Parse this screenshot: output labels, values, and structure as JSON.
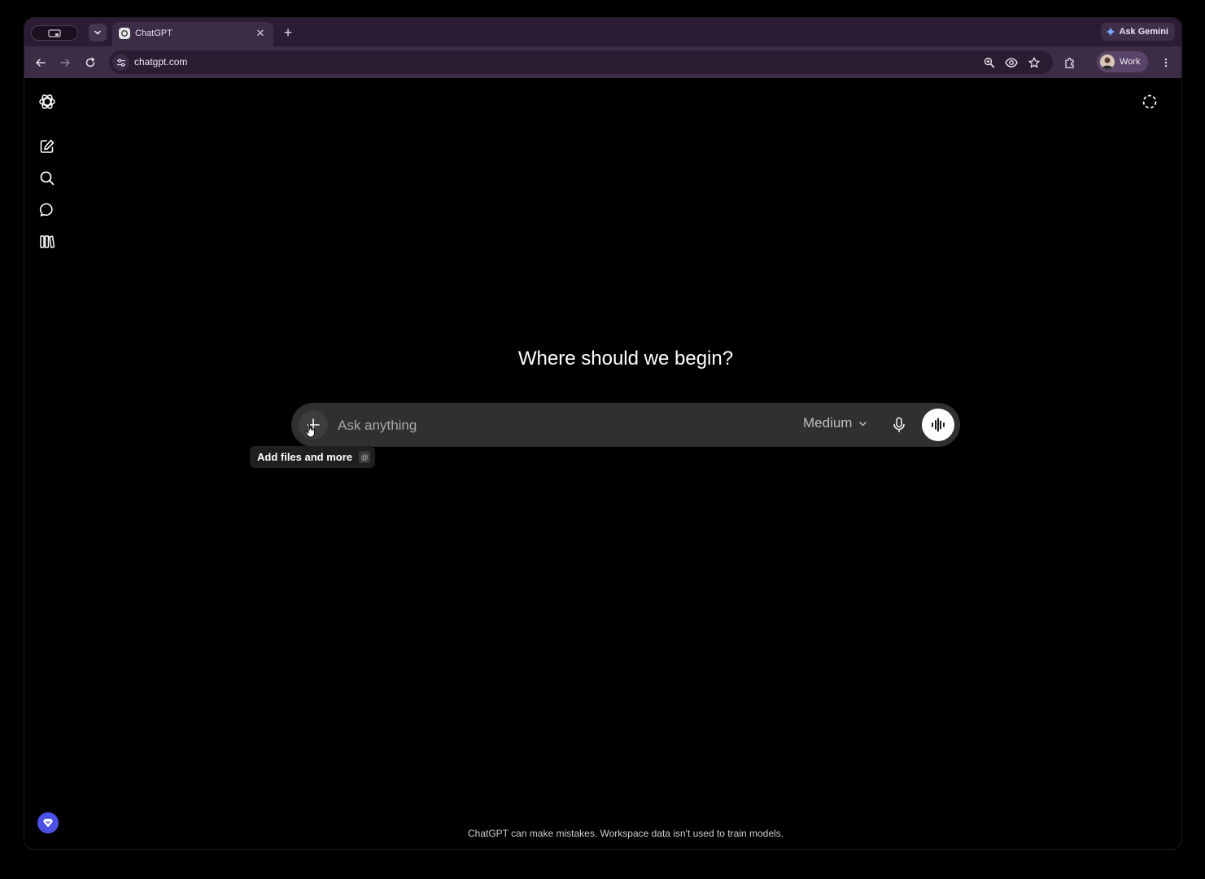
{
  "browser": {
    "tabs": [
      {
        "title": "ChatGPT",
        "active": true
      }
    ],
    "ask_gemini_label": "Ask Gemini",
    "url": "chatgpt.com",
    "profile_label": "Work"
  },
  "sidebar": {
    "items": [
      {
        "icon": "openai-logo-icon"
      },
      {
        "icon": "new-chat-icon"
      },
      {
        "icon": "search-icon"
      },
      {
        "icon": "chat-icon"
      },
      {
        "icon": "library-icon"
      }
    ]
  },
  "main": {
    "heading": "Where should we begin?",
    "composer": {
      "placeholder": "Ask anything",
      "model_label": "Medium"
    },
    "tooltip": {
      "text": "Add files and more",
      "shortcut": "@"
    },
    "disclaimer": "ChatGPT can make mistakes. Workspace data isn't used to train models."
  },
  "colors": {
    "browser_frame": "#2b1b33",
    "toolbar": "#3c2c46",
    "composer_bg": "#303030",
    "help_button": "#4b50e6"
  }
}
